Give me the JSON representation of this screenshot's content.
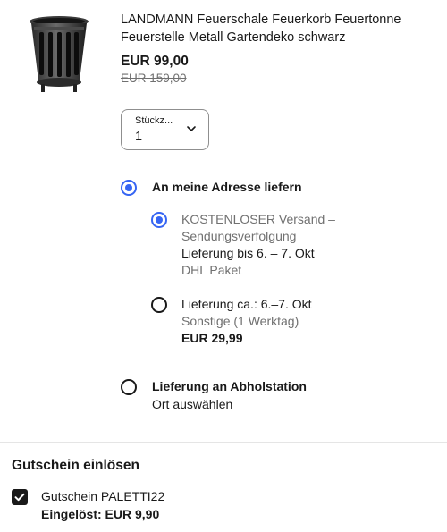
{
  "product": {
    "title": "LANDMANN Feuerschale Feuerkorb Feuertonne Feuerstelle Metall Gartendeko schwarz",
    "price": "EUR 99,00",
    "old_price": "EUR 159,00",
    "image_icon": "fire-basket-image"
  },
  "quantity": {
    "label": "Stückz...",
    "value": "1"
  },
  "delivery": {
    "home": {
      "label": "An meine Adresse liefern",
      "selected": true
    },
    "options": [
      {
        "line1": "KOSTENLOSER Versand –",
        "line2": "Sendungsverfolgung",
        "line3": "Lieferung bis 6. – 7. Okt",
        "line4": "DHL Paket",
        "selected": true
      },
      {
        "line1": "Lieferung ca.: 6.–7. Okt",
        "line2": "Sonstige (1 Werktag)",
        "line3": "EUR 29,99",
        "selected": false
      }
    ],
    "pickup": {
      "label": "Lieferung an Abholstation",
      "sub": "Ort auswählen",
      "selected": false
    }
  },
  "voucher": {
    "title": "Gutschein einlösen",
    "name": "Gutschein PALETTI22",
    "redeemed": "Eingelöst: EUR 9,90",
    "checked": true
  },
  "colors": {
    "accent": "#3665f3",
    "text": "#191919",
    "muted": "#707070"
  }
}
